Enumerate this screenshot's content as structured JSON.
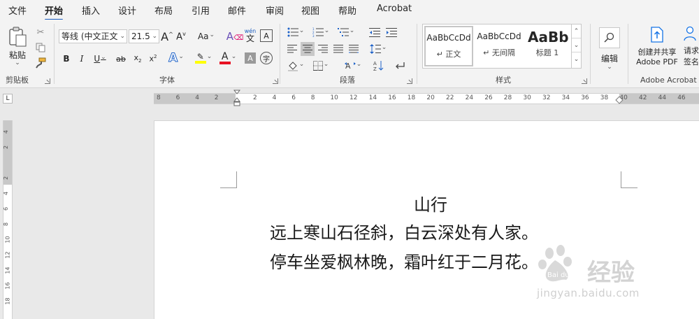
{
  "menu": {
    "tabs": [
      "文件",
      "开始",
      "插入",
      "设计",
      "布局",
      "引用",
      "邮件",
      "审阅",
      "视图",
      "帮助",
      "Acrobat"
    ],
    "active": "开始"
  },
  "clipboard": {
    "paste_label": "粘贴",
    "group_label": "剪贴板"
  },
  "font": {
    "font_name": "等线 (中文正文",
    "font_size": "21.5",
    "group_label": "字体",
    "change_case": "Aa",
    "phonetic_top": "wén",
    "phonetic_bottom": "文"
  },
  "paragraph": {
    "group_label": "段落"
  },
  "styles": {
    "group_label": "样式",
    "items": [
      {
        "preview": "AaBbCcDd",
        "name": "↵ 正文"
      },
      {
        "preview": "AaBbCcDd",
        "name": "↵ 无间隔"
      },
      {
        "preview": "AaBb",
        "name": "标题 1"
      }
    ]
  },
  "editing": {
    "label": "编辑"
  },
  "acrobat": {
    "create_share": "创建并共享",
    "adobe_pdf": "Adobe PDF",
    "request_1": "请求",
    "request_2": "签名",
    "group_label": "Adobe Acrobat"
  },
  "ruler": {
    "numbers": [
      "8",
      "6",
      "4",
      "2",
      "",
      "2",
      "4",
      "6",
      "8",
      "10",
      "12",
      "14",
      "16",
      "18",
      "20",
      "22",
      "24",
      "26",
      "28",
      "30",
      "32",
      "34",
      "36",
      "38",
      "40",
      "42",
      "44",
      "46"
    ],
    "vnumbers": [
      "4",
      "2",
      "",
      "2",
      "4",
      "6",
      "8",
      "10",
      "12",
      "14",
      "16",
      "18"
    ]
  },
  "document": {
    "title": "山行",
    "line1": "远上寒山石径斜，白云深处有人家。",
    "line2": "停车坐爱枫林晚，霜叶红于二月花。"
  },
  "watermark": {
    "brand": "经验",
    "bai_du": "Bai du",
    "url": "jingyan.baidu.com"
  },
  "colors": {
    "accent": "#185abd",
    "highlight": "#ffff00",
    "font_color": "#e81123",
    "acrobat_blue": "#1473e6"
  }
}
